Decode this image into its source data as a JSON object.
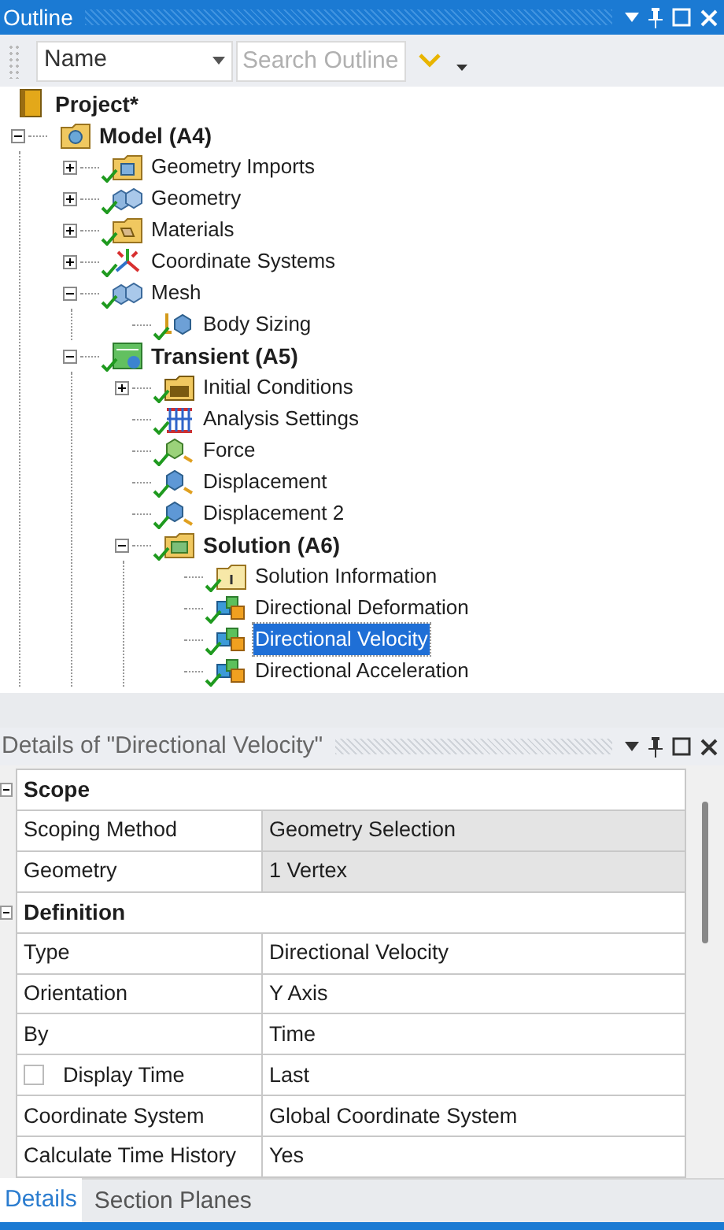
{
  "outline": {
    "title": "Outline",
    "toolbar": {
      "column": "Name",
      "search_placeholder": "Search Outline"
    },
    "tree": {
      "label": "Project*",
      "kind": "project",
      "bold": true,
      "children": [
        {
          "label": "Model (A4)",
          "kind": "model",
          "bold": true,
          "expanded": true,
          "children": [
            {
              "label": "Geometry Imports",
              "kind": "imports",
              "ok": true,
              "expanded": false
            },
            {
              "label": "Geometry",
              "kind": "geometry",
              "ok": true,
              "expanded": false
            },
            {
              "label": "Materials",
              "kind": "materials",
              "ok": true,
              "expanded": false
            },
            {
              "label": "Coordinate Systems",
              "kind": "coordinates",
              "ok": true,
              "expanded": false
            },
            {
              "label": "Mesh",
              "kind": "geometry",
              "ok": true,
              "expanded": true,
              "children": [
                {
                  "label": "Body Sizing",
                  "kind": "sizing",
                  "ok": true
                }
              ]
            },
            {
              "label": "Transient (A5)",
              "kind": "analysis",
              "ok": true,
              "bold": true,
              "expanded": true,
              "children": [
                {
                  "label": "Initial Conditions",
                  "kind": "initial",
                  "ok": true,
                  "expanded": false
                },
                {
                  "label": "Analysis Settings",
                  "kind": "settings",
                  "ok": true
                },
                {
                  "label": "Force",
                  "kind": "load",
                  "ok": true
                },
                {
                  "label": "Displacement",
                  "kind": "support",
                  "ok": true
                },
                {
                  "label": "Displacement 2",
                  "kind": "support",
                  "ok": true
                },
                {
                  "label": "Solution (A6)",
                  "kind": "solution",
                  "ok": true,
                  "bold": true,
                  "expanded": true,
                  "children": [
                    {
                      "label": "Solution Information",
                      "kind": "info",
                      "ok": true,
                      "selected": false
                    },
                    {
                      "label": "Directional Deformation",
                      "kind": "result",
                      "ok": true,
                      "selected": false
                    },
                    {
                      "label": "Directional Velocity",
                      "kind": "result",
                      "ok": true,
                      "selected": true
                    },
                    {
                      "label": "Directional Acceleration",
                      "kind": "result",
                      "ok": true,
                      "selected": false
                    }
                  ]
                }
              ]
            }
          ]
        }
      ]
    }
  },
  "details": {
    "title": "Details of \"Directional Velocity\"",
    "rows": [
      {
        "kind": "group",
        "label": "Scope",
        "expanded": true
      },
      {
        "kind": "property",
        "label": "Scoping Method",
        "value": "Geometry Selection",
        "shaded": true
      },
      {
        "kind": "property",
        "label": "Geometry",
        "value": "1 Vertex",
        "shaded": true
      },
      {
        "kind": "group",
        "label": "Definition",
        "expanded": true
      },
      {
        "kind": "property",
        "label": "Type",
        "value": "Directional Velocity",
        "shaded": false
      },
      {
        "kind": "property",
        "label": "Orientation",
        "value": "Y Axis",
        "shaded": false
      },
      {
        "kind": "property",
        "label": "By",
        "value": "Time",
        "shaded": false
      },
      {
        "kind": "checkbox",
        "label": "Display Time",
        "value": "Last",
        "checked": false,
        "shaded": false
      },
      {
        "kind": "property",
        "label": "Coordinate System",
        "value": "Global Coordinate System",
        "shaded": false
      },
      {
        "kind": "property",
        "label": "Calculate Time History",
        "value": "Yes",
        "shaded": false
      }
    ]
  },
  "tabs": [
    {
      "label": "Details",
      "selected": true
    },
    {
      "label": "Section Planes",
      "selected": false
    }
  ]
}
